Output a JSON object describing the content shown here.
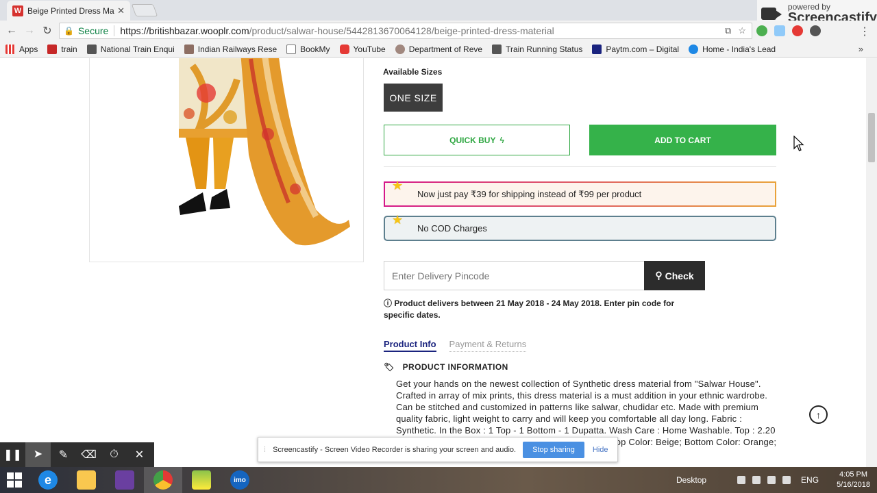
{
  "browser": {
    "tab_title": "Beige Printed Dress Mate",
    "tab_favicon": "W",
    "secure_label": "Secure",
    "url_host": "https://britishbazar.wooplr.com",
    "url_path": "/product/salwar-house/5442813670064128/beige-printed-dress-material",
    "castify_powered": "powered by",
    "castify_name": "Screencastify"
  },
  "bookmarks": [
    {
      "label": "Apps",
      "icon": "apps-icon",
      "color": "#e53935"
    },
    {
      "label": "train",
      "icon": "train-icon",
      "color": "#c62828"
    },
    {
      "label": "National Train Enqui",
      "icon": "train-icon",
      "color": "#555"
    },
    {
      "label": "Indian Railways Rese",
      "icon": "train-icon",
      "color": "#8d6e63"
    },
    {
      "label": "BookMy",
      "icon": "page-icon",
      "color": "#ffffff"
    },
    {
      "label": "YouTube",
      "icon": "youtube-icon",
      "color": "#e53935"
    },
    {
      "label": "Department of Reve",
      "icon": "emblem-icon",
      "color": "#a1887f"
    },
    {
      "label": "Train Running Status",
      "icon": "train-icon",
      "color": "#555"
    },
    {
      "label": "Paytm.com – Digital",
      "icon": "paytm-icon",
      "color": "#1a237e"
    },
    {
      "label": "Home - India's Lead",
      "icon": "check-icon",
      "color": "#1e88e5"
    }
  ],
  "product": {
    "sizes_label": "Available Sizes",
    "size_value": "ONE SIZE",
    "quick_buy": "QUICK BUY",
    "add_to_cart": "ADD TO CART",
    "offer_shipping": "Now just pay ₹39 for shipping instead of ₹99 per product",
    "offer_cod": "No COD Charges",
    "pincode_placeholder": "Enter Delivery Pincode",
    "check_label": "Check",
    "delivery_note": "Product delivers between 21 May 2018 - 24 May 2018. Enter pin code for specific dates.",
    "tab_info": "Product Info",
    "tab_payment": "Payment & Returns",
    "info_heading": "PRODUCT INFORMATION",
    "info_text": "Get your hands on the newest collection of Synthetic dress material from \"Salwar House\". Crafted in array of mix prints, this dress material is a must addition in your ethnic wardrobe. Can be stitched and customized in patterns like salwar, chudidar etc. Made with premium quality fabric, light weight to carry and will keep you comfortable all day long. Fabric : Synthetic. In the Box : 1 Top - 1 Bottom - 1 Dupatta. Wash Care : Home Washable. Top : 2.20 mtrs; Bottom : 2.00 mtrs; Dupatta : 2.20 mtrs. Fabric Top Color: Beige; Bottom Color: Orange; Dupatta Color: Beige."
  },
  "screencastify": {
    "share_text": "Screencastify - Screen Video Recorder is sharing your screen and audio.",
    "stop_label": "Stop sharing",
    "hide_label": "Hide"
  },
  "taskbar": {
    "desktop_label": "Desktop",
    "lang": "ENG",
    "time": "4:05 PM",
    "date": "5/16/2018",
    "imo_label": "imo"
  }
}
